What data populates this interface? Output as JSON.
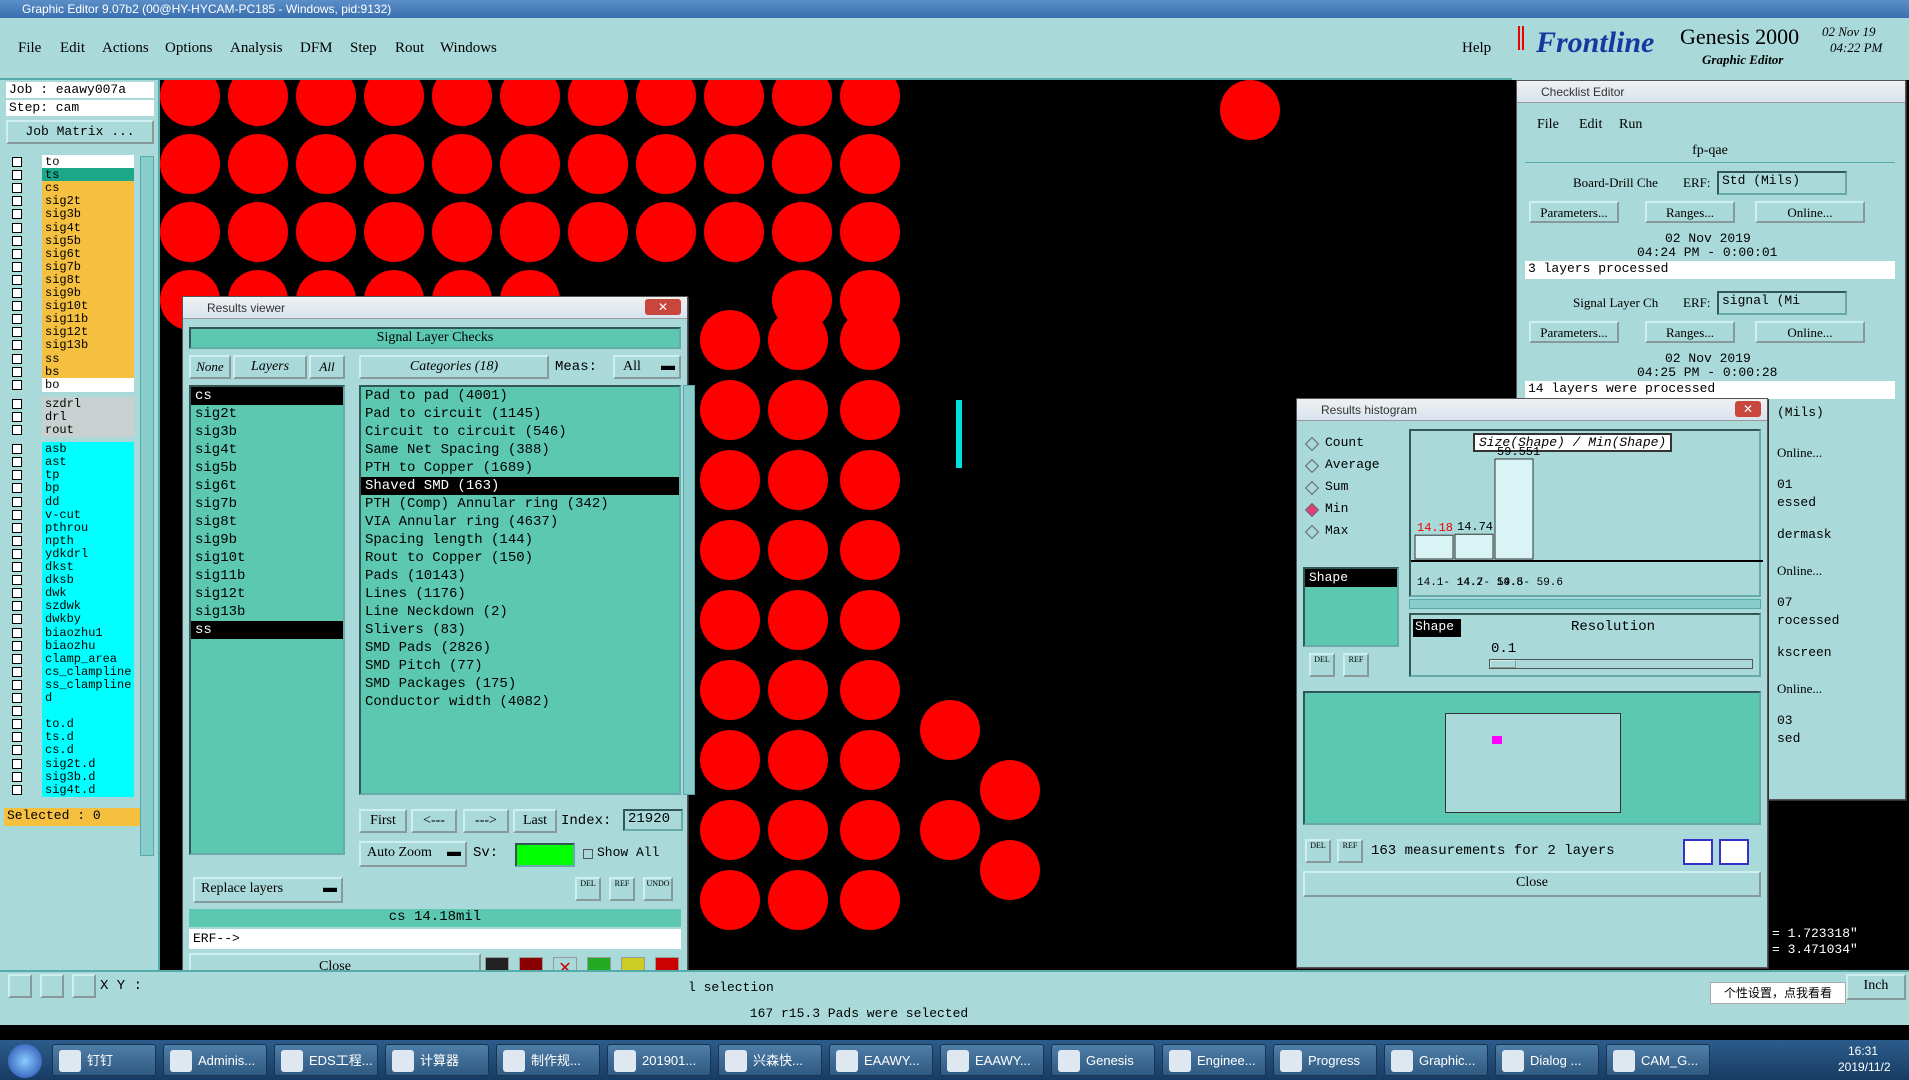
{
  "titlebar": {
    "title": "Graphic Editor 9.07b2 (00@HY-HYCAM-PC185 - Windows, pid:9132)"
  },
  "menu": {
    "items": [
      "File",
      "Edit",
      "Actions",
      "Options",
      "Analysis",
      "DFM",
      "Step",
      "Rout",
      "Windows"
    ],
    "help": "Help"
  },
  "logo": {
    "brand": "Frontline",
    "product": "Genesis 2000",
    "subtitle": "Graphic Editor",
    "date": "02 Nov 19",
    "time": "04:22 PM"
  },
  "job": {
    "job_label": "Job : eaawy007a",
    "step_label": "Step: cam",
    "matrix_button": "Job Matrix ..."
  },
  "layers": {
    "group1": [
      "to",
      "ts",
      "cs",
      "sig2t",
      "sig3b",
      "sig4t",
      "sig5b",
      "sig6t",
      "sig7b",
      "sig8t",
      "sig9b",
      "sig10t",
      "sig11b",
      "sig12t",
      "sig13b",
      "ss",
      "bs",
      "bo"
    ],
    "group2": [
      "szdrl",
      "drl",
      "rout"
    ],
    "group3": [
      "asb",
      "ast",
      "tp",
      "bp",
      "dd",
      "v-cut",
      "pthrou",
      "npth",
      "ydkdrl",
      "dkst",
      "dksb",
      "dwk",
      "szdwk",
      "dwkby",
      "biaozhu1",
      "biaozhu",
      "clamp_area",
      "cs_clampline",
      "ss_clampline",
      "d",
      "",
      "to.d",
      "ts.d",
      "cs.d",
      "sig2t.d",
      "sig3b.d",
      "sig4t.d"
    ],
    "selected_label": "Selected : 0"
  },
  "results_viewer": {
    "title": "Results viewer",
    "heading": "Signal Layer Checks",
    "none_button": "None",
    "layers_label": "Layers",
    "all_button": "All",
    "categories_label": "Categories (18)",
    "meas_label": "Meas:",
    "meas_value": "All",
    "layer_list": [
      "cs",
      "sig2t",
      "sig3b",
      "sig4t",
      "sig5b",
      "sig6t",
      "sig7b",
      "sig8t",
      "sig9b",
      "sig10t",
      "sig11b",
      "sig12t",
      "sig13b",
      "ss"
    ],
    "category_list": [
      "Pad to pad (4001)",
      "Pad to circuit (1145)",
      "Circuit to circuit (546)",
      "Same Net Spacing (388)",
      "PTH to Copper (1689)",
      "Shaved SMD (163)",
      "PTH (Comp) Annular ring (342)",
      "VIA Annular ring (4637)",
      "Spacing length (144)",
      "Rout to Copper (150)",
      "Pads (10143)",
      "Lines (1176)",
      "Line Neckdown (2)",
      "Slivers (83)",
      "SMD Pads (2826)",
      "SMD Pitch (77)",
      "SMD Packages (175)",
      "Conductor width (4082)"
    ],
    "first_button": "First",
    "prev_button": "<---",
    "next_button": "--->",
    "last_button": "Last",
    "index_label": "Index:",
    "index_value": "21920",
    "auto_zoom": "Auto Zoom",
    "sv_label": "Sv:",
    "show_all": "Show All",
    "replace_layers": "Replace layers",
    "del": "DEL",
    "ref": "REF",
    "undo": "UNDO",
    "status": "cs 14.18mil",
    "erf_prompt": "ERF-->",
    "close": "Close"
  },
  "checklist": {
    "title": "Checklist Editor",
    "menu": [
      "File",
      "Edit",
      "Run"
    ],
    "name": "fp-qae",
    "erf": "ERF:",
    "params": "Parameters...",
    "ranges": "Ranges...",
    "online": "Online...",
    "item1": {
      "name": "Board-Drill Che",
      "erf_value": "Std (Mils)",
      "date": "02 Nov 2019",
      "time": "04:24 PM - 0:00:01",
      "status": "3 layers processed"
    },
    "item2": {
      "name": "Signal Layer Ch",
      "erf_value": "signal (Mi",
      "date": "02 Nov 2019",
      "time": "04:25 PM - 0:00:28",
      "status": "14 layers were processed"
    },
    "partial": [
      "(Mils)",
      "01",
      "essed",
      "dermask",
      "07",
      "rocessed",
      "kscreen",
      "03",
      "sed"
    ]
  },
  "histogram": {
    "title": "Results histogram",
    "modes": [
      "Count",
      "Average",
      "Sum",
      "Min",
      "Max"
    ],
    "selected_mode": "Min",
    "shape_label": "Shape",
    "chart_title": "Size(Shape) / Min(Shape)",
    "bars": [
      {
        "label": "14.18",
        "range": "14.1- 14.2"
      },
      {
        "label": "14.74",
        "range": "14.7- 14.8"
      },
      {
        "label": "59.551",
        "range": "59.5- 59.6"
      }
    ],
    "resolution_label": "Resolution",
    "resolution_value": "0.1",
    "del": "DEL",
    "ref": "REF",
    "summary": "163 measurements for 2 layers",
    "close": "Close"
  },
  "status": {
    "xy_label": "X Y :",
    "selection": "l selection",
    "message": "167 r15.3 Pads were selected",
    "coord_x": "= 1.723318\"",
    "coord_y": "= 3.471034\"",
    "units": "Inch",
    "tooltip": "个性设置，点我看看"
  },
  "taskbar": {
    "items": [
      "钉钉",
      "Adminis...",
      "EDS工程...",
      "计算器",
      "制作规...",
      "201901...",
      "兴森快...",
      "EAAWY...",
      "EAAWY...",
      "Genesis",
      "Enginee...",
      "Progress",
      "Graphic...",
      "Dialog ...",
      "CAM_G..."
    ],
    "time": "16:31",
    "date": "2019/11/2"
  }
}
